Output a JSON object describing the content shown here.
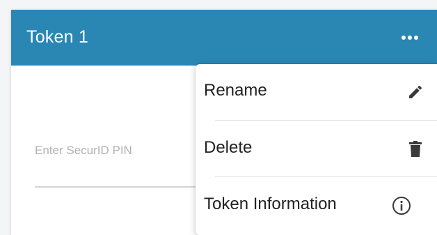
{
  "token": {
    "title": "Token 1",
    "menu_icon": "more-horizontal-icon"
  },
  "pin": {
    "placeholder": "Enter SecurID PIN",
    "value": ""
  },
  "menu": {
    "items": [
      {
        "label": "Rename",
        "icon": "pencil-icon"
      },
      {
        "label": "Delete",
        "icon": "trash-icon"
      },
      {
        "label": "Token Information",
        "icon": "info-circle-icon"
      }
    ]
  },
  "colors": {
    "header_bg": "#2a87b4",
    "header_text": "#ffffff",
    "icon": "#3a3a3a"
  }
}
